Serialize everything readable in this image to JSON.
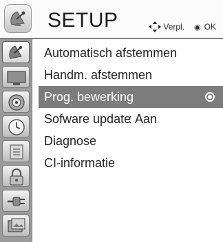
{
  "header": {
    "title": "SETUP",
    "hint_move_label": "Verpl.",
    "hint_ok_glyph": "◉",
    "hint_ok_label": "OK"
  },
  "categories": [
    {
      "name": "setup-icon",
      "active": true
    },
    {
      "name": "picture-icon",
      "active": false
    },
    {
      "name": "audio-icon",
      "active": false
    },
    {
      "name": "time-icon",
      "active": false
    },
    {
      "name": "option-icon",
      "active": false
    },
    {
      "name": "lock-icon",
      "active": false
    },
    {
      "name": "input-icon",
      "active": false
    },
    {
      "name": "media-icon",
      "active": false
    }
  ],
  "menu": {
    "items": [
      {
        "label": "Automatisch afstemmen",
        "value": "",
        "selected": false
      },
      {
        "label": "Handm. afstemmen",
        "value": "",
        "selected": false
      },
      {
        "label": "Prog. bewerking",
        "value": "",
        "selected": true
      },
      {
        "label": "Sofware update",
        "value": ": Aan",
        "selected": false
      },
      {
        "label": "Diagnose",
        "value": "",
        "selected": false
      },
      {
        "label": "CI-informatie",
        "value": "",
        "selected": false
      }
    ]
  },
  "colors": {
    "selection": "#7c7c7c",
    "icon_column": "#9b9b9b",
    "text": "#1e1e1e"
  }
}
